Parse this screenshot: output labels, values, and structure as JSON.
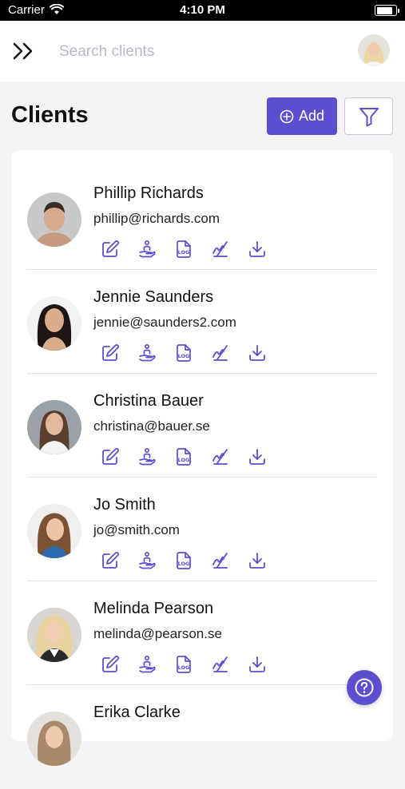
{
  "status_bar": {
    "carrier": "Carrier",
    "time": "4:10 PM"
  },
  "header": {
    "search_placeholder": "Search clients",
    "menu_icon": "double-chevron-right-icon",
    "user_avatar": "user-avatar"
  },
  "page": {
    "title": "Clients",
    "add_label": "Add",
    "filter_icon": "filter-icon"
  },
  "colors": {
    "accent": "#5b4fcf",
    "background": "#f4f4f6",
    "card": "#ffffff"
  },
  "action_icons": [
    "edit-icon",
    "hand-person-icon",
    "log-file-icon",
    "signature-icon",
    "download-icon"
  ],
  "clients": [
    {
      "name": "Phillip Richards",
      "email": "phillip@richards.com"
    },
    {
      "name": "Jennie Saunders",
      "email": "jennie@saunders2.com"
    },
    {
      "name": "Christina Bauer",
      "email": "christina@bauer.se"
    },
    {
      "name": "Jo Smith",
      "email": "jo@smith.com"
    },
    {
      "name": "Melinda Pearson",
      "email": "melinda@pearson.se"
    },
    {
      "name": "Erika Clarke",
      "email": ""
    }
  ],
  "help_icon": "help-icon"
}
